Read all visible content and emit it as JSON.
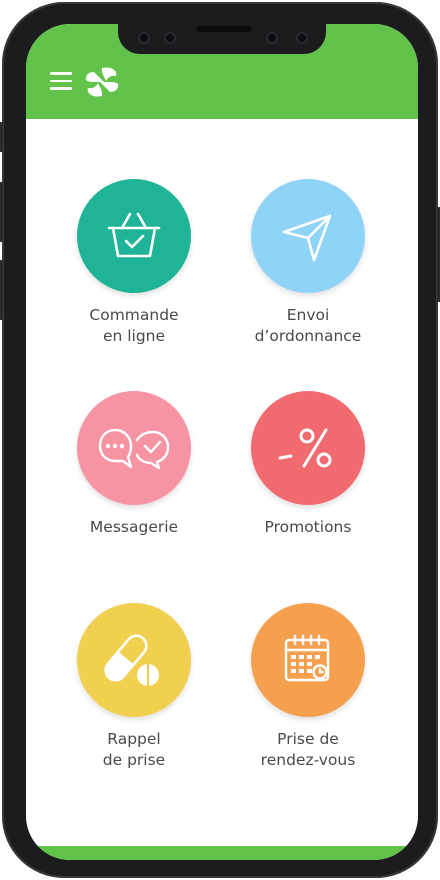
{
  "app": {
    "accent": "#62c34a",
    "icons": {
      "menu": "hamburger-icon",
      "logo": "pharmacy-leaf-logo"
    }
  },
  "tiles": [
    {
      "label": "Commande\nen ligne",
      "color": "#1fb496",
      "icon": "basket-check-icon"
    },
    {
      "label": "Envoi\nd’ordonnance",
      "color": "#8fd3f7",
      "icon": "send-plane-icon"
    },
    {
      "label": "Messagerie",
      "color": "#f794a4",
      "icon": "chat-bubbles-icon"
    },
    {
      "label": "Promotions",
      "color": "#f06a70",
      "icon": "percent-icon"
    },
    {
      "label": "Rappel\nde prise",
      "color": "#f1d04f",
      "icon": "pills-icon"
    },
    {
      "label": "Prise de\nrendez-vous",
      "color": "#f4a04e",
      "icon": "calendar-icon"
    }
  ]
}
